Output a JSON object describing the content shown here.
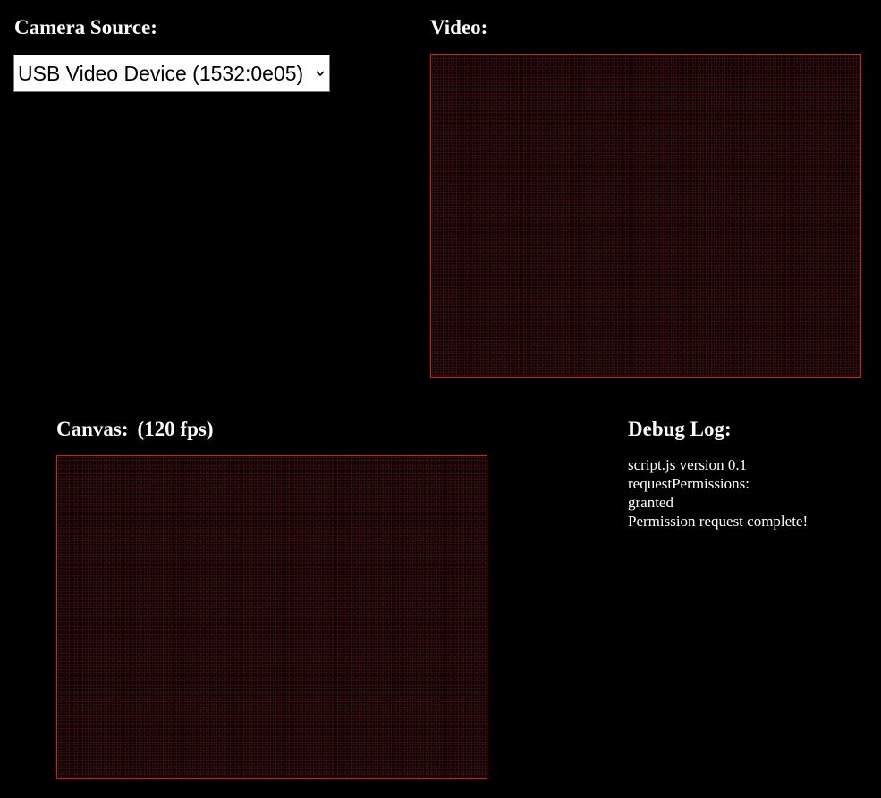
{
  "camera": {
    "label": "Camera Source:",
    "selected": "USB Video Device (1532:0e05)"
  },
  "video": {
    "label": "Video:"
  },
  "canvas": {
    "label": "Canvas:",
    "fps": "(120 fps)"
  },
  "debug": {
    "label": "Debug Log:",
    "lines": [
      "script.js version 0.1",
      "requestPermissions:",
      "granted",
      "Permission request complete!"
    ]
  },
  "colors": {
    "background": "#000000",
    "feed_border": "#d61b1b"
  }
}
